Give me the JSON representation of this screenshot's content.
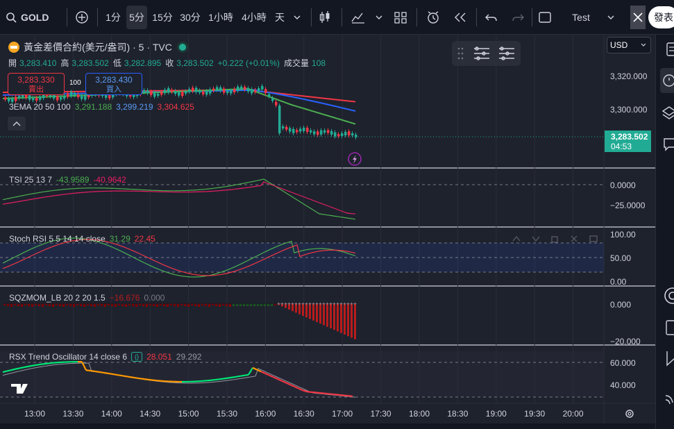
{
  "toolbar": {
    "symbol": "GOLD",
    "intervals": [
      "1分",
      "5分",
      "15分",
      "30分",
      "1小時",
      "4小時",
      "天"
    ],
    "active_interval": "5分",
    "layout_name": "Test",
    "publish_label": "發表"
  },
  "header": {
    "title": "黃金差價合約(美元/盎司) · 5 · TVC",
    "ohlc": {
      "open_label": "開",
      "open": "3,283.410",
      "high_label": "高",
      "high": "3,283.502",
      "low_label": "低",
      "low": "3,282.895",
      "close_label": "收",
      "close": "3,283.502",
      "change": "+0.222 (+0.01%)",
      "volume_label": "成交量",
      "volume": "108"
    },
    "sell": {
      "price": "3,283.330",
      "label": "賣出"
    },
    "buy": {
      "price": "3,283.430",
      "label": "買入"
    },
    "spread": "100"
  },
  "price_scale": {
    "currency": "USD",
    "ticks": [
      "3,320.000",
      "3,300.000"
    ],
    "last_price": "3,283.502",
    "countdown": "04:53"
  },
  "indicators": {
    "ema": {
      "name": "3EMA 20 50 100",
      "v1": "3,291.188",
      "v2": "3,299.219",
      "v3": "3,304.625"
    },
    "tsi": {
      "name": "TSI 25 13 7",
      "v1": "-43.9589",
      "v2": "-40.9642",
      "ticks": [
        "0.0000",
        "−25.0000"
      ]
    },
    "stoch": {
      "name": "Stoch RSI 5 5 14 14 close",
      "v1": "31.29",
      "v2": "22.45",
      "ticks": [
        "100.00",
        "50.00",
        "0.00"
      ]
    },
    "sqz": {
      "name": "SQZMOM_LB 20 2 20 1.5",
      "v1": "−16.676",
      "v2": "0.000",
      "ticks": [
        "0.000",
        "−20.000"
      ]
    },
    "rsx": {
      "name": "RSX Trend Oscillator 14 close 6",
      "v1": "28.051",
      "v2": "29.292",
      "ticks": [
        "60.000",
        "40.000"
      ]
    }
  },
  "time_axis": [
    "13:00",
    "13:30",
    "14:00",
    "14:30",
    "15:00",
    "15:30",
    "16:00",
    "16:30",
    "17:00",
    "17:30",
    "18:00",
    "18:30",
    "19:00",
    "19:30",
    "20:00"
  ],
  "colors": {
    "up": "#22ab94",
    "down": "#f23645",
    "ema20": "#4caf50",
    "ema50": "#2962ff",
    "ema100": "#f23645",
    "background": "#1e222d",
    "panel_bg": "#131722"
  },
  "icons": [
    "add-symbol-icon",
    "candles-icon",
    "indicators-icon",
    "layout-icon",
    "alert-icon",
    "replay-icon",
    "undo-icon",
    "redo-icon",
    "fullscreen-icon",
    "settings-icon",
    "tradingview-logo",
    "lightning-icon"
  ]
}
